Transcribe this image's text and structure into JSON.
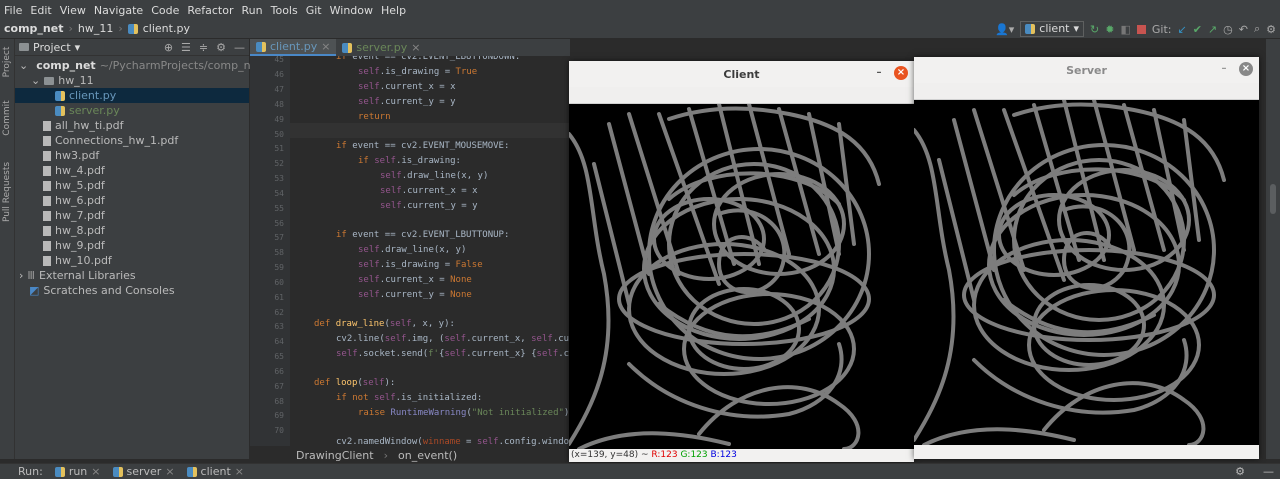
{
  "menu": [
    "File",
    "Edit",
    "View",
    "Navigate",
    "Code",
    "Refactor",
    "Run",
    "Tools",
    "Git",
    "Window",
    "Help"
  ],
  "nav": {
    "project": "comp_net",
    "folder": "hw_11",
    "file": "client.py"
  },
  "toolbar": {
    "run_config": "client",
    "git_label": "Git:"
  },
  "project_panel": {
    "title": "Project",
    "root_name": "comp_net",
    "root_path": "~/PycharmProjects/comp_net",
    "folder": "hw_11",
    "files_in_folder": [
      "client.py",
      "server.py"
    ],
    "files": [
      "all_hw_ti.pdf",
      "Connections_hw_1.pdf",
      "hw3.pdf",
      "hw_4.pdf",
      "hw_5.pdf",
      "hw_6.pdf",
      "hw_7.pdf",
      "hw_8.pdf",
      "hw_9.pdf",
      "hw_10.pdf"
    ],
    "external": "External Libraries",
    "scratches": "Scratches and Consoles"
  },
  "sidebar_tabs": [
    "Project",
    "Commit",
    "Pull Requests"
  ],
  "editor": {
    "tabs": [
      "client.py",
      "server.py"
    ],
    "line_numbers": [
      "45",
      "46",
      "47",
      "48",
      "49",
      "50",
      "51",
      "52",
      "53",
      "54",
      "55",
      "56",
      "57",
      "58",
      "59",
      "60",
      "61",
      "62",
      "63",
      "64",
      "65",
      "66",
      "67",
      "68",
      "69",
      "70"
    ],
    "breadcrumb": [
      "DrawingClient",
      "on_event()"
    ]
  },
  "client_window": {
    "title": "Client",
    "status_prefix": "(x=139, y=48) ~ ",
    "r": "R:123",
    "g": "G:123",
    "b": "B:123"
  },
  "server_window": {
    "title": "Server"
  },
  "run_bar": {
    "label": "Run:",
    "tabs": [
      "run",
      "server",
      "client"
    ]
  }
}
